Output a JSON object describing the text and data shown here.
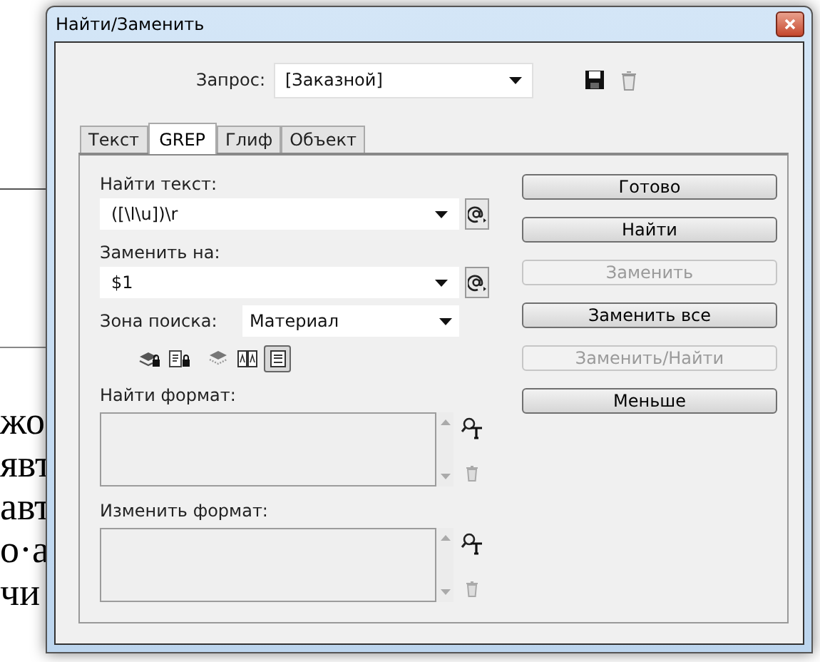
{
  "background_document": {
    "lines": [
      "жо",
      "явт",
      "авт",
      "о·а",
      "чи"
    ]
  },
  "window": {
    "title": "Найти/Заменить"
  },
  "query": {
    "label": "Запрос:",
    "value": "[Заказной]"
  },
  "tabs": [
    {
      "label": "Текст",
      "selected": false
    },
    {
      "label": "GREP",
      "selected": true
    },
    {
      "label": "Глиф",
      "selected": false
    },
    {
      "label": "Объект",
      "selected": false
    }
  ],
  "find_text": {
    "label": "Найти текст:",
    "value": "([\\l\\u])\\r"
  },
  "replace_with": {
    "label": "Заменить на:",
    "value": "$1"
  },
  "search_zone": {
    "label": "Зона поиска:",
    "value": "Материал"
  },
  "zone_options": [
    {
      "kind": "locked-layers",
      "selected": false
    },
    {
      "kind": "locked-stories",
      "selected": false
    },
    {
      "kind": "hidden-layers",
      "selected": false
    },
    {
      "kind": "master-pages",
      "selected": false
    },
    {
      "kind": "footnotes",
      "selected": true
    }
  ],
  "find_format": {
    "label": "Найти формат:"
  },
  "change_format": {
    "label": "Изменить формат:"
  },
  "buttons": [
    {
      "label": "Готово",
      "disabled": false
    },
    {
      "label": "Найти",
      "disabled": false
    },
    {
      "label": "Заменить",
      "disabled": true
    },
    {
      "label": "Заменить все",
      "disabled": false
    },
    {
      "label": "Заменить/Найти",
      "disabled": true
    },
    {
      "label": "Меньше",
      "disabled": false
    }
  ]
}
